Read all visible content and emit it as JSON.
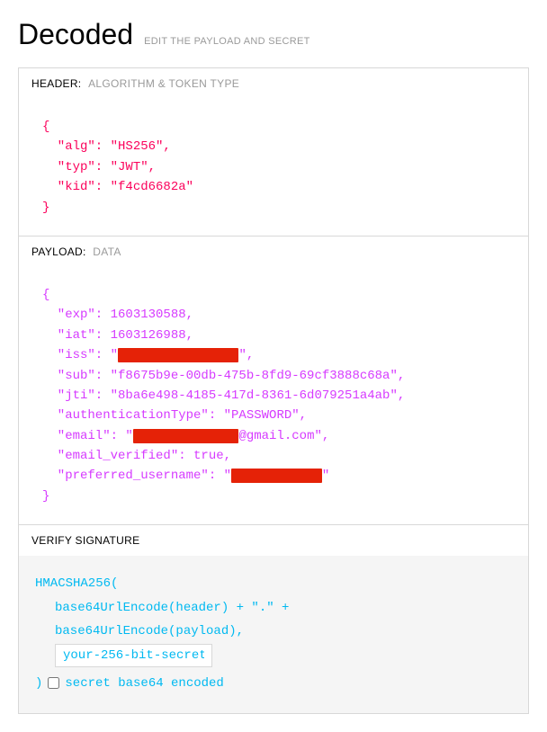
{
  "title": "Decoded",
  "subtitle": "EDIT THE PAYLOAD AND SECRET",
  "header_section": {
    "label": "HEADER:",
    "sublabel": "ALGORITHM & TOKEN TYPE",
    "json": "{\n  \"alg\": \"HS256\",\n  \"typ\": \"JWT\",\n  \"kid\": \"f4cd6682a\"\n}"
  },
  "payload_section": {
    "label": "PAYLOAD:",
    "sublabel": "DATA",
    "json_prefix": "{\n  \"exp\": 1603130588,\n  \"iat\": 1603126988,\n  \"iss\": \"",
    "iss_redacted": "XXXXXXXXXXXXXXXX",
    "json_mid1": "\",\n  \"sub\": \"f8675b9e-00db-475b-8fd9-69cf3888c68a\",\n  \"jti\": \"8ba6e498-4185-417d-8361-6d079251a4ab\",\n  \"authenticationType\": \"PASSWORD\",\n  \"email\": \"",
    "email_redacted": "XXXXXXXXXXXXXX",
    "json_mid2": "@gmail.com\",\n  \"email_verified\": true,\n  \"preferred_username\": \"",
    "pu_redacted": "XXXXXXXXXXXX",
    "json_suffix": "\"\n}"
  },
  "verify_section": {
    "label": "VERIFY SIGNATURE",
    "line1": "HMACSHA256(",
    "line2": "base64UrlEncode(header) + \".\" +",
    "line3": "base64UrlEncode(payload),",
    "secret_value": "your-256-bit-secret",
    "close_paren": ")",
    "checkbox_label": "secret base64 encoded"
  }
}
